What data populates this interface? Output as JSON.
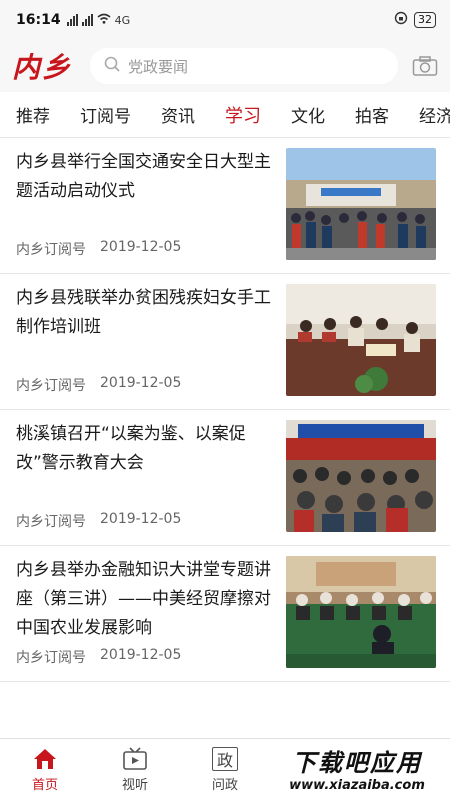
{
  "status_bar": {
    "time": "16:14",
    "network_label": "4G",
    "battery": "32"
  },
  "header": {
    "logo_text": "内乡",
    "search_placeholder": "党政要闻",
    "camera_icon": "camera-icon"
  },
  "tabs": [
    {
      "label": "推荐",
      "active": false
    },
    {
      "label": "订阅号",
      "active": false
    },
    {
      "label": "资讯",
      "active": false
    },
    {
      "label": "学习",
      "active": true
    },
    {
      "label": "文化",
      "active": false
    },
    {
      "label": "拍客",
      "active": false
    },
    {
      "label": "经济",
      "active": false
    }
  ],
  "news": [
    {
      "title": "内乡县举行全国交通安全日大型主题活动启动仪式",
      "source": "内乡订阅号",
      "date": "2019-12-05"
    },
    {
      "title": "内乡县残联举办贫困残疾妇女手工制作培训班",
      "source": "内乡订阅号",
      "date": "2019-12-05"
    },
    {
      "title": "桃溪镇召开“以案为鉴、以案促改”警示教育大会",
      "source": "内乡订阅号",
      "date": "2019-12-05"
    },
    {
      "title": "内乡县举办金融知识大讲堂专题讲座（第三讲）——中美经贸摩擦对中国农业发展影响",
      "source": "内乡订阅号",
      "date": "2019-12-05"
    }
  ],
  "bottom_nav": [
    {
      "label": "首页",
      "icon": "home-icon",
      "active": true
    },
    {
      "label": "视听",
      "icon": "tv-icon",
      "active": false
    },
    {
      "label": "问政",
      "icon": "zheng-icon",
      "icon_char": "政",
      "active": false
    }
  ],
  "watermark": {
    "main": "下载吧应用",
    "url": "www.xiazaiba.com"
  },
  "colors": {
    "accent": "#c8161d",
    "divider": "#e6e6e6"
  }
}
